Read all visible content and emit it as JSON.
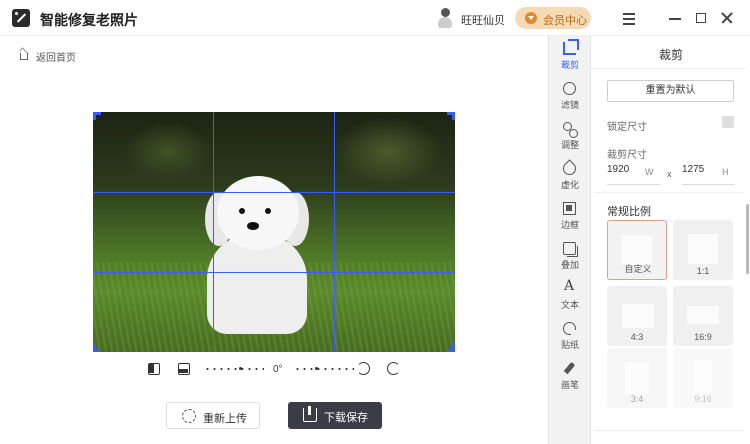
{
  "app": {
    "title": "智能修复老照片"
  },
  "user": {
    "name": "旺旺仙贝",
    "member_label": "会员中心"
  },
  "nav": {
    "home_label": "返回首页"
  },
  "editor": {
    "rotation_label": "0°"
  },
  "actions": {
    "reupload_label": "重新上传",
    "download_label": "下载保存"
  },
  "tools": [
    {
      "label": "裁剪",
      "icon": "crop-icon",
      "active": true
    },
    {
      "label": "滤镜",
      "icon": "filter-icon"
    },
    {
      "label": "调整",
      "icon": "adjust-icon"
    },
    {
      "label": "虚化",
      "icon": "blur-icon"
    },
    {
      "label": "边框",
      "icon": "border-icon"
    },
    {
      "label": "叠加",
      "icon": "overlay-icon"
    },
    {
      "label": "文本",
      "icon": "text-icon"
    },
    {
      "label": "贴纸",
      "icon": "sticker-icon"
    },
    {
      "label": "画笔",
      "icon": "brush-icon"
    }
  ],
  "crop_panel": {
    "title": "裁剪",
    "reset_label": "重置为默认",
    "lock_label": "锁定尺寸",
    "size_label": "裁剪尺寸",
    "width_value": "1920",
    "width_unit": "W",
    "separator": "x",
    "height_value": "1275",
    "height_unit": "H",
    "ratio_section": "常规比例",
    "ratios": [
      "自定义",
      "1:1",
      "4:3",
      "16:9",
      "3:4",
      "9:16"
    ]
  },
  "colors": {
    "accent": "#3a5cff",
    "member": "#f5d9b5",
    "dark_button": "#3a3d46"
  }
}
